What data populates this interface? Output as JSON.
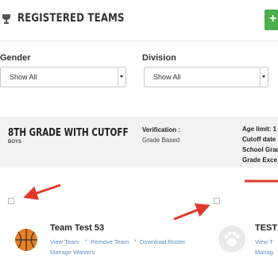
{
  "header": {
    "title": "REGISTERED TEAMS",
    "add_label": "+",
    "trophy_icon": "trophy-icon",
    "accent": "#4cae4c"
  },
  "filters": {
    "gender_label": "Gender",
    "gender_value": "Show All",
    "division_label": "Division",
    "division_value": "Show All"
  },
  "division": {
    "name": "8TH GRADE WITH CUTOFF",
    "sub": "BOYS",
    "verification_label": "Verification :",
    "verification_value": "Grade Based",
    "age_limit": "Age limit: 1",
    "cutoff": "Cutoff date",
    "school_grade": "School Grad",
    "grade_exception": "Grade Exce"
  },
  "teams": [
    {
      "name": "Team Test 53",
      "logo_icon": "basketball-icon",
      "links": [
        "View Team",
        "Remove Team",
        "Download Roster",
        "Manage Waivers"
      ]
    },
    {
      "name": "TEST",
      "logo_icon": "paw-icon",
      "links": [
        "View T",
        "Manag"
      ]
    }
  ],
  "annotation_color": "#e0392b"
}
